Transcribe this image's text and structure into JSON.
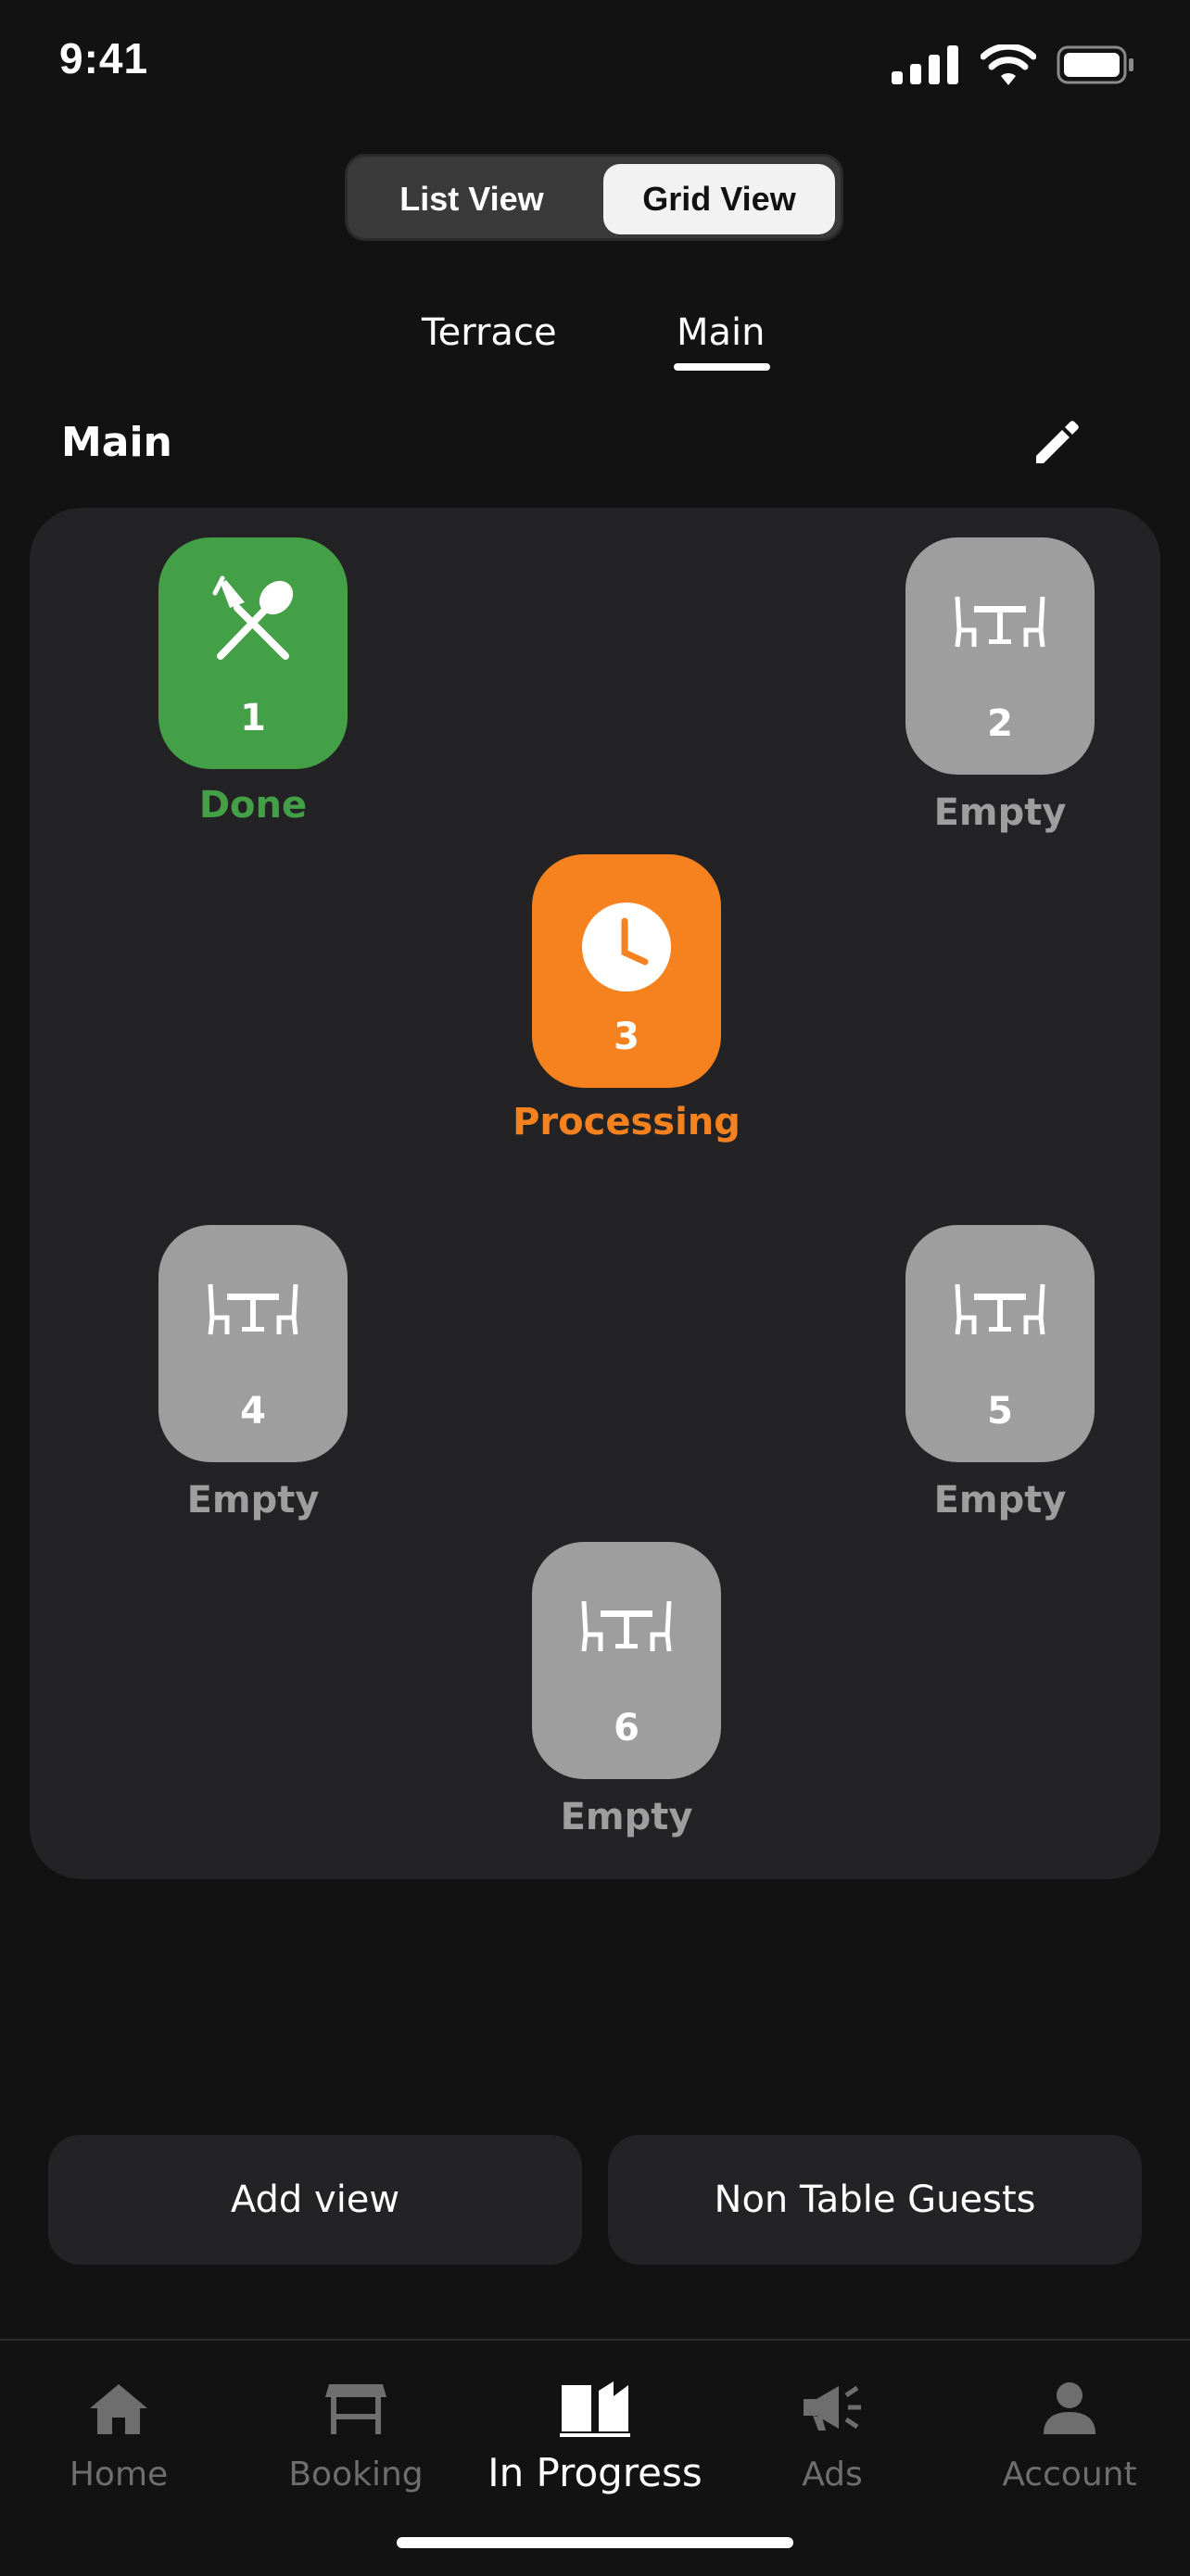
{
  "status": {
    "time": "9:41"
  },
  "view_toggle": {
    "list_label": "List View",
    "grid_label": "Grid View",
    "selected": "Grid View"
  },
  "areas": {
    "tabs": [
      "Terrace",
      "Main"
    ],
    "active": "Main"
  },
  "section": {
    "title": "Main"
  },
  "tables": [
    {
      "number": "1",
      "status": "Done",
      "state": "done",
      "icon": "fork-spoon-icon"
    },
    {
      "number": "2",
      "status": "Empty",
      "state": "empty",
      "icon": "table-chairs-icon"
    },
    {
      "number": "3",
      "status": "Processing",
      "state": "processing",
      "icon": "clock-icon"
    },
    {
      "number": "4",
      "status": "Empty",
      "state": "empty",
      "icon": "table-chairs-icon"
    },
    {
      "number": "5",
      "status": "Empty",
      "state": "empty",
      "icon": "table-chairs-icon"
    },
    {
      "number": "6",
      "status": "Empty",
      "state": "empty",
      "icon": "table-chairs-icon"
    }
  ],
  "actions": {
    "add_view": "Add view",
    "non_table_guests": "Non Table Guests"
  },
  "nav": {
    "items": [
      {
        "label": "Home",
        "icon": "home-icon"
      },
      {
        "label": "Booking",
        "icon": "booking-table-icon"
      },
      {
        "label": "In Progress",
        "icon": "open-book-icon"
      },
      {
        "label": "Ads",
        "icon": "megaphone-icon"
      },
      {
        "label": "Account",
        "icon": "person-icon"
      }
    ],
    "active": "In Progress"
  },
  "colors": {
    "done": "#43a047",
    "processing": "#f5821f",
    "empty": "#9e9e9e",
    "background": "#121212",
    "surface": "#232325"
  }
}
